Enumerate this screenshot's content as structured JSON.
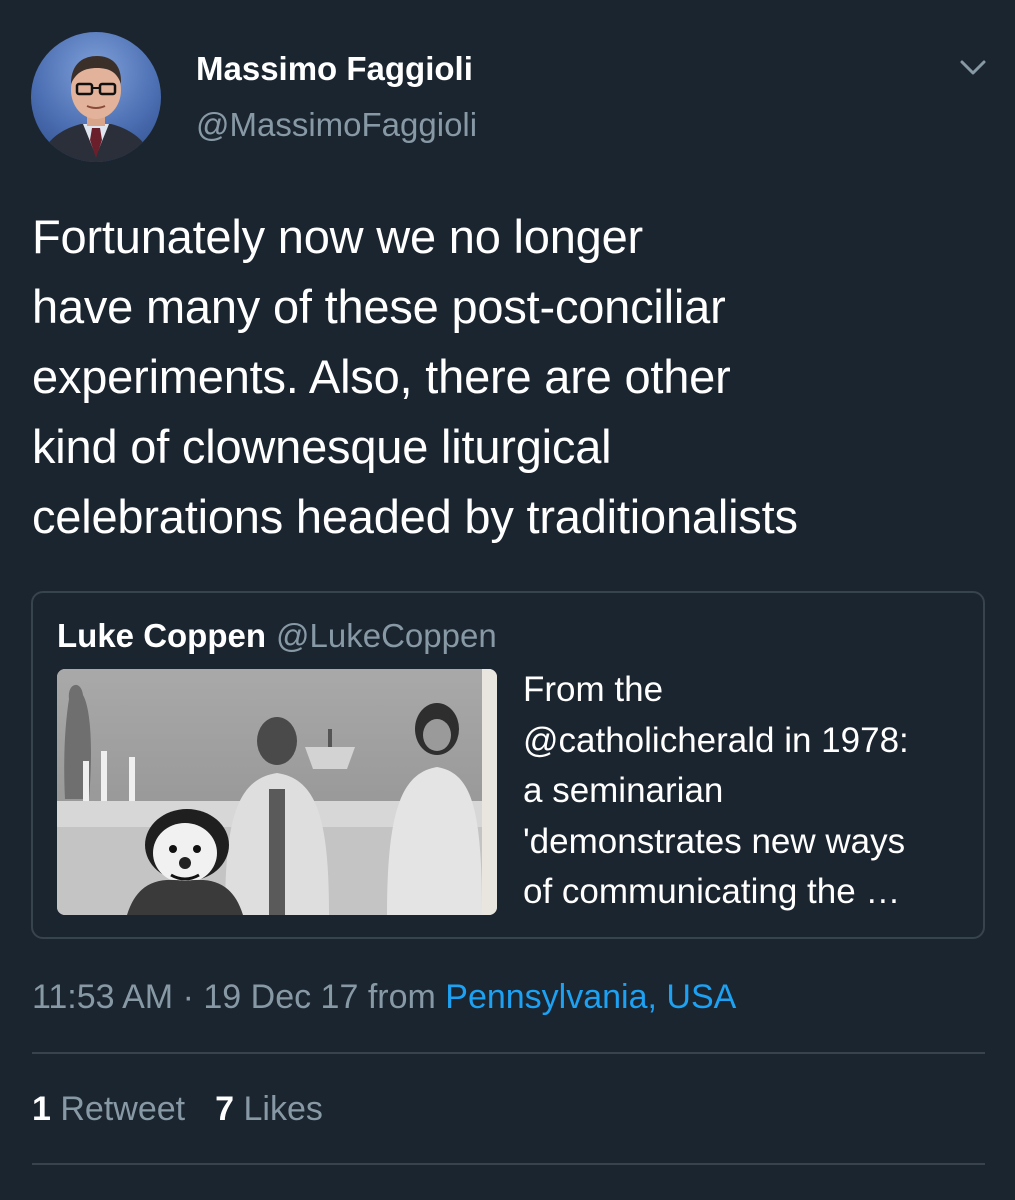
{
  "tweet": {
    "author": {
      "name": "Massimo Faggioli",
      "handle": "@MassimoFaggioli",
      "avatar_icon": "profile-photo"
    },
    "menu_icon": "chevron-down-icon",
    "text": "Fortunately now we no longer\nhave many of these post-conciliar\nexperiments. Also, there are other\nkind of clownesque liturgical\ncelebrations headed by traditionalists",
    "quoted": {
      "name": "Luke Coppen",
      "handle": "@LukeCoppen",
      "text": "From the\n@catholicherald in 1978:\na seminarian\n'demonstrates new ways\nof communicating the …"
    },
    "meta": {
      "time": "11:53 AM",
      "separator": "·",
      "date": "19 Dec 17",
      "from_label": "from",
      "location": "Pennsylvania, USA"
    },
    "stats": {
      "retweets_count": "1",
      "retweets_label": "Retweet",
      "likes_count": "7",
      "likes_label": "Likes"
    }
  },
  "colors": {
    "background": "#1b2530",
    "primary_text": "#ffffff",
    "secondary_text": "#8899a6",
    "link": "#1da1f2",
    "border": "#38444d"
  }
}
